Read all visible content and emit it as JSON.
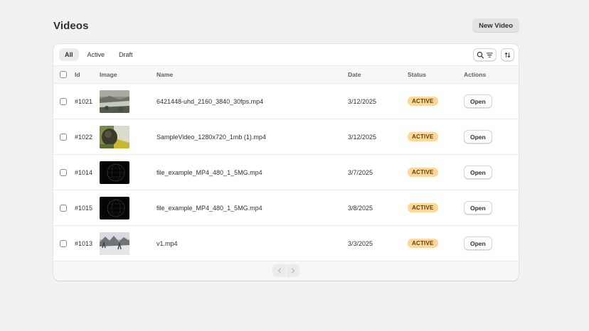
{
  "page": {
    "title": "Videos",
    "new_button": "New Video"
  },
  "tabs": [
    {
      "label": "All",
      "selected": true
    },
    {
      "label": "Active",
      "selected": false
    },
    {
      "label": "Draft",
      "selected": false
    }
  ],
  "toolbar": {
    "search_filter_icon": "search-filter-icon",
    "sort_icon": "sort-icon"
  },
  "columns": {
    "id": "Id",
    "image": "Image",
    "name": "Name",
    "date": "Date",
    "status": "Status",
    "actions": "Actions"
  },
  "rows": [
    {
      "id": "#1021",
      "name": "6421448-uhd_2160_3840_30fps.mp4",
      "date": "3/12/2025",
      "status": "ACTIVE",
      "action": "Open",
      "thumb": "landscape"
    },
    {
      "id": "#1022",
      "name": "SampleVideo_1280x720_1mb (1).mp4",
      "date": "3/12/2025",
      "status": "ACTIVE",
      "action": "Open",
      "thumb": "animal"
    },
    {
      "id": "#1014",
      "name": "file_example_MP4_480_1_5MG.mp4",
      "date": "3/7/2025",
      "status": "ACTIVE",
      "action": "Open",
      "thumb": "dark-globe"
    },
    {
      "id": "#1015",
      "name": "file_example_MP4_480_1_5MG.mp4",
      "date": "3/8/2025",
      "status": "ACTIVE",
      "action": "Open",
      "thumb": "dark-globe"
    },
    {
      "id": "#1013",
      "name": "v1.mp4",
      "date": "3/3/2025",
      "status": "ACTIVE",
      "action": "Open",
      "thumb": "winter"
    }
  ],
  "pagination": {
    "prev_icon": "chevron-left-icon",
    "next_icon": "chevron-right-icon"
  },
  "colors": {
    "badge_bg": "#ffd79d",
    "badge_text": "#5e4200",
    "page_bg": "#f1f1f1"
  }
}
